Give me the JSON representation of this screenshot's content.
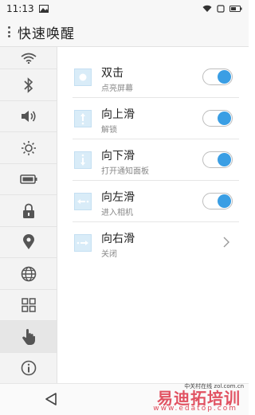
{
  "status_bar": {
    "time": "11:13"
  },
  "app_bar": {
    "title": "快速唤醒"
  },
  "sidebar": {
    "items": [
      {
        "icon": "wifi-icon"
      },
      {
        "icon": "bluetooth-icon"
      },
      {
        "icon": "volume-icon"
      },
      {
        "icon": "brightness-icon"
      },
      {
        "icon": "battery-icon"
      },
      {
        "icon": "lock-icon"
      },
      {
        "icon": "location-icon"
      },
      {
        "icon": "globe-icon"
      },
      {
        "icon": "apps-grid-icon"
      },
      {
        "icon": "hand-gesture-icon",
        "active": true
      },
      {
        "icon": "info-icon"
      }
    ]
  },
  "gestures": [
    {
      "label": "双击",
      "sub": "点亮屏幕",
      "toggle": true,
      "icon": "double-tap-icon"
    },
    {
      "label": "向上滑",
      "sub": "解锁",
      "toggle": true,
      "icon": "swipe-up-icon"
    },
    {
      "label": "向下滑",
      "sub": "打开通知面板",
      "toggle": true,
      "icon": "swipe-down-icon"
    },
    {
      "label": "向左滑",
      "sub": "进入相机",
      "toggle": true,
      "icon": "swipe-left-icon"
    },
    {
      "label": "向右滑",
      "sub": "关闭",
      "toggle": false,
      "icon": "swipe-right-icon"
    }
  ],
  "colors": {
    "accent": "#3a9ee4",
    "thumb_bg": "#d9ecf8"
  },
  "watermark": {
    "text": "易迪拓培训",
    "url": "www.edatop.com",
    "small": "中关村在线 zol.com.cn"
  }
}
